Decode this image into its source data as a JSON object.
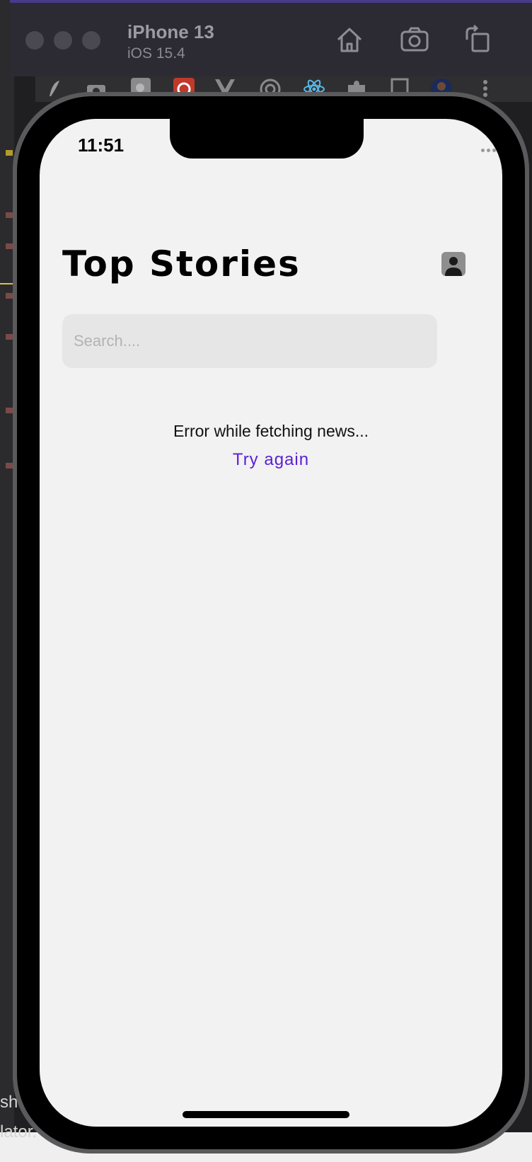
{
  "simulator": {
    "device_name": "iPhone 13",
    "os_version": "iOS 15.4"
  },
  "background": {
    "bottom_text_1": "sh",
    "bottom_text_2": "lator."
  },
  "status_bar": {
    "time": "11:51"
  },
  "app": {
    "title": "Top Stories",
    "search": {
      "placeholder": "Search....",
      "value": ""
    },
    "error_message": "Error while fetching news...",
    "retry_label": "Try again"
  },
  "colors": {
    "accent": "#5b1fd6",
    "screen_bg": "#f2f2f2",
    "search_bg": "#e6e6e6"
  },
  "icons": {
    "simulator_toolbar": [
      "home-icon",
      "screenshot-icon",
      "rotate-icon"
    ],
    "status": [
      "signal-icon",
      "wifi-icon",
      "battery-icon"
    ],
    "header": [
      "profile-avatar-icon"
    ]
  }
}
